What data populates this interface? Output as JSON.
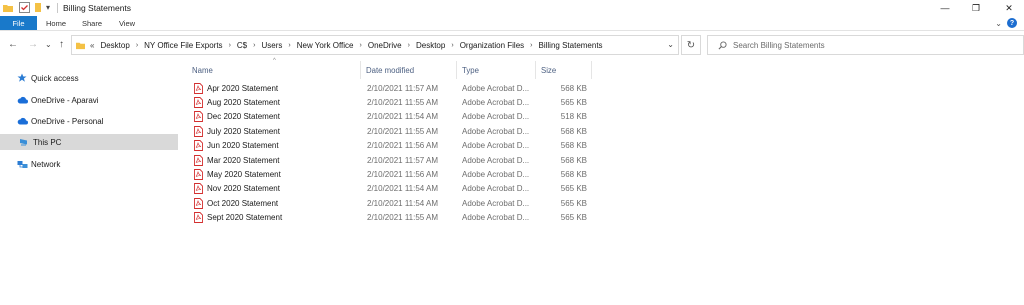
{
  "window": {
    "title": "Billing Statements",
    "minimize": "—",
    "maximize": "❐",
    "close": "✕"
  },
  "quick_access_toolbar": {
    "dropdown": "▾"
  },
  "ribbon": {
    "tabs": [
      "File",
      "Home",
      "Share",
      "View"
    ],
    "expand": "⌄",
    "help": "?"
  },
  "nav": {
    "back": "←",
    "forward": "→",
    "recent": "⌄",
    "up": "↑",
    "overflow": "«",
    "breadcrumbs": [
      "Desktop",
      "NY Office File Exports",
      "C$",
      "Users",
      "New York Office",
      "OneDrive",
      "Desktop",
      "Organization Files",
      "Billing Statements"
    ],
    "separator": "›",
    "address_dropdown": "⌄",
    "refresh": "↻",
    "search_placeholder": "Search Billing Statements"
  },
  "sidebar": {
    "items": [
      {
        "label": "Quick access",
        "icon": "star-icon"
      },
      {
        "label": "OneDrive - Aparavi",
        "icon": "cloud-icon"
      },
      {
        "label": "OneDrive - Personal",
        "icon": "cloud-icon"
      },
      {
        "label": "This PC",
        "icon": "computer-icon",
        "selected": true
      },
      {
        "label": "Network",
        "icon": "network-icon"
      }
    ]
  },
  "columns": {
    "name": "Name",
    "date": "Date modified",
    "type": "Type",
    "size": "Size",
    "sort_indicator": "^"
  },
  "files": [
    {
      "name": "Apr 2020 Statement",
      "date": "2/10/2021 11:57 AM",
      "type": "Adobe Acrobat D...",
      "size": "568 KB"
    },
    {
      "name": "Aug 2020 Statement",
      "date": "2/10/2021 11:55 AM",
      "type": "Adobe Acrobat D...",
      "size": "565 KB"
    },
    {
      "name": "Dec 2020 Statement",
      "date": "2/10/2021 11:54 AM",
      "type": "Adobe Acrobat D...",
      "size": "518 KB"
    },
    {
      "name": "July 2020 Statement",
      "date": "2/10/2021 11:55 AM",
      "type": "Adobe Acrobat D...",
      "size": "568 KB"
    },
    {
      "name": "Jun 2020 Statement",
      "date": "2/10/2021 11:56 AM",
      "type": "Adobe Acrobat D...",
      "size": "568 KB"
    },
    {
      "name": "Mar 2020 Statement",
      "date": "2/10/2021 11:57 AM",
      "type": "Adobe Acrobat D...",
      "size": "568 KB"
    },
    {
      "name": "May 2020 Statement",
      "date": "2/10/2021 11:56 AM",
      "type": "Adobe Acrobat D...",
      "size": "568 KB"
    },
    {
      "name": "Nov 2020 Statement",
      "date": "2/10/2021 11:54 AM",
      "type": "Adobe Acrobat D...",
      "size": "565 KB"
    },
    {
      "name": "Oct 2020 Statement",
      "date": "2/10/2021 11:54 AM",
      "type": "Adobe Acrobat D...",
      "size": "565 KB"
    },
    {
      "name": "Sept 2020 Statement",
      "date": "2/10/2021 11:55 AM",
      "type": "Adobe Acrobat D...",
      "size": "565 KB"
    }
  ],
  "colors": {
    "file_tab": "#1979ca",
    "selected_item": "#d9d9d9",
    "column_header_text": "#4d6082",
    "pdf_icon": "#d32f2f",
    "folder_icon": "#f4c145"
  }
}
